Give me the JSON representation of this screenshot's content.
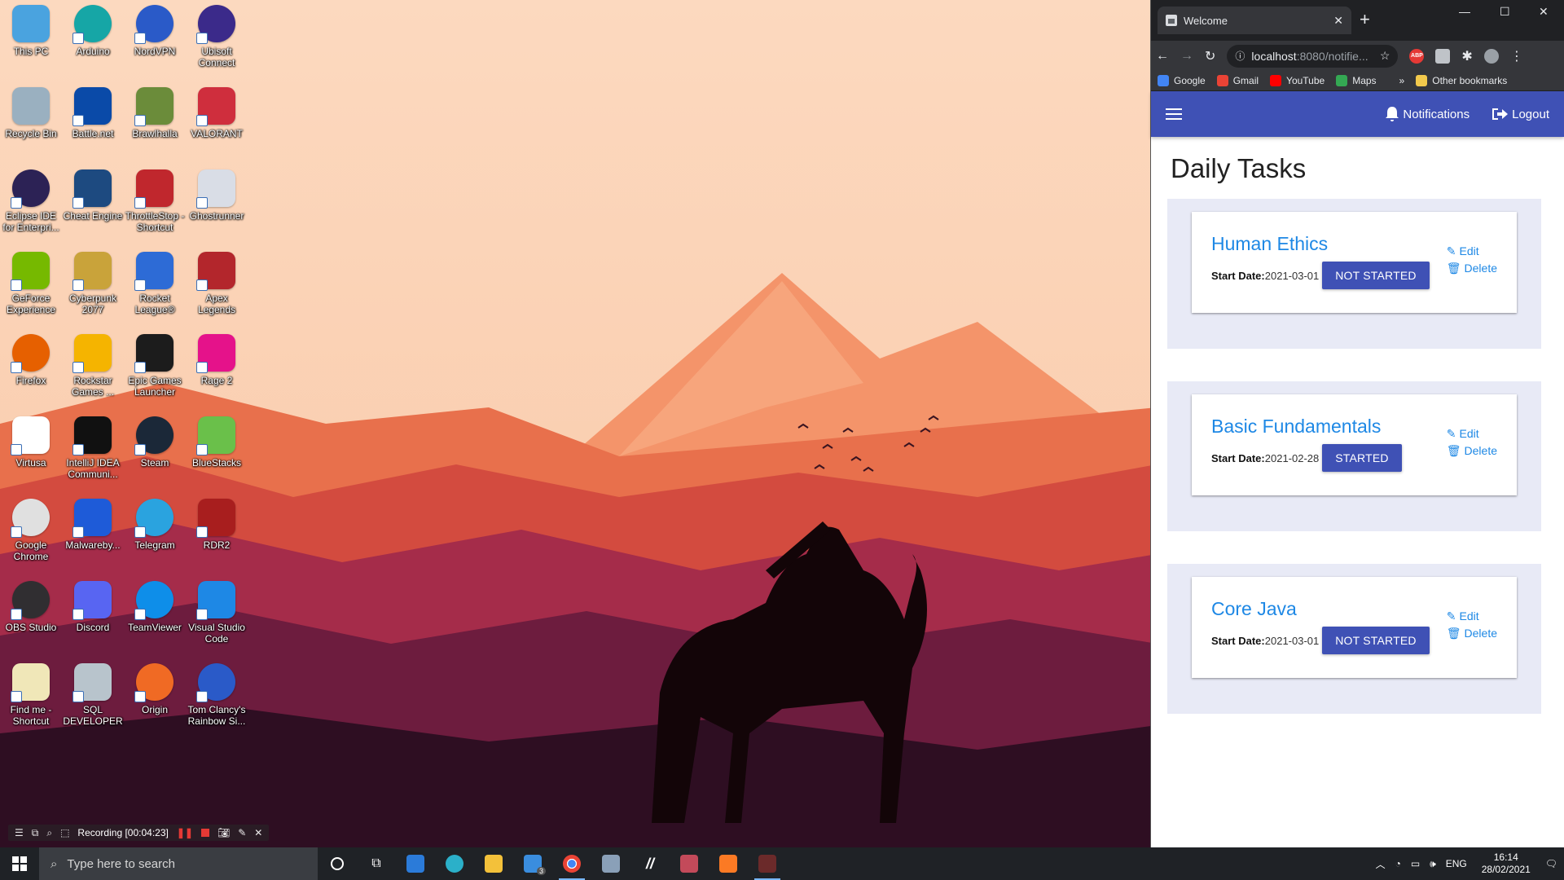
{
  "desktop": {
    "icons": [
      {
        "label": "This PC",
        "icon": "monitor-icon",
        "color": "#4aa3df"
      },
      {
        "label": "Arduino",
        "icon": "arduino-icon",
        "color": "#16a6a6"
      },
      {
        "label": "NordVPN",
        "icon": "nordvpn-icon",
        "color": "#2a5ac8"
      },
      {
        "label": "Ubisoft Connect",
        "icon": "ubisoft-icon",
        "color": "#3b2a8a"
      },
      {
        "label": "Recycle Bin",
        "icon": "recycle-bin-icon",
        "color": "#9ab0c0"
      },
      {
        "label": "Battle.net",
        "icon": "battlenet-icon",
        "color": "#0a4aa8"
      },
      {
        "label": "Brawlhalla",
        "icon": "brawlhalla-icon",
        "color": "#6b8c3a"
      },
      {
        "label": "VALORANT",
        "icon": "valorant-icon",
        "color": "#cf2e3d"
      },
      {
        "label": "Eclipse IDE for Enterpri...",
        "icon": "eclipse-icon",
        "color": "#2c2255"
      },
      {
        "label": "Cheat Engine",
        "icon": "cheat-engine-icon",
        "color": "#1d4a80"
      },
      {
        "label": "ThrottleStop - Shortcut",
        "icon": "throttlestop-icon",
        "color": "#c0272d"
      },
      {
        "label": "Ghostrunner",
        "icon": "ghostrunner-icon",
        "color": "#d9dde6"
      },
      {
        "label": "GeForce Experience",
        "icon": "geforce-icon",
        "color": "#76b900"
      },
      {
        "label": "Cyberpunk 2077",
        "icon": "cyberpunk-icon",
        "color": "#c9a33a"
      },
      {
        "label": "Rocket League®",
        "icon": "rocket-league-icon",
        "color": "#2d6bd6"
      },
      {
        "label": "Apex Legends",
        "icon": "apex-icon",
        "color": "#b3262c"
      },
      {
        "label": "Firefox",
        "icon": "firefox-icon",
        "color": "#e66000"
      },
      {
        "label": "Rockstar Games ...",
        "icon": "rockstar-icon",
        "color": "#f5b400"
      },
      {
        "label": "Epic Games Launcher",
        "icon": "epic-games-icon",
        "color": "#1c1c1c"
      },
      {
        "label": "Rage 2",
        "icon": "rage2-icon",
        "color": "#e5128a"
      },
      {
        "label": "Virtusa",
        "icon": "examly-icon",
        "color": "#ffffff"
      },
      {
        "label": "IntelliJ IDEA Communi...",
        "icon": "intellij-icon",
        "color": "#111111"
      },
      {
        "label": "Steam",
        "icon": "steam-icon",
        "color": "#1b2838"
      },
      {
        "label": "BlueStacks",
        "icon": "bluestacks-icon",
        "color": "#6ac04a"
      },
      {
        "label": "Google Chrome",
        "icon": "chrome-icon",
        "color": "#e0e0e0"
      },
      {
        "label": "Malwareby...",
        "icon": "malwarebytes-icon",
        "color": "#1e5bd8"
      },
      {
        "label": "Telegram",
        "icon": "telegram-icon",
        "color": "#2aa3df"
      },
      {
        "label": "RDR2",
        "icon": "rdr2-icon",
        "color": "#a81e1e"
      },
      {
        "label": "OBS Studio",
        "icon": "obs-icon",
        "color": "#302e31"
      },
      {
        "label": "Discord",
        "icon": "discord-icon",
        "color": "#5865f2"
      },
      {
        "label": "TeamViewer",
        "icon": "teamviewer-icon",
        "color": "#0e8ee9"
      },
      {
        "label": "Visual Studio Code",
        "icon": "vscode-icon",
        "color": "#1e88e5"
      },
      {
        "label": "Find me - Shortcut",
        "icon": "file-icon",
        "color": "#f0e7b8"
      },
      {
        "label": "SQL DEVELOPER",
        "icon": "sql-developer-icon",
        "color": "#b8c4cc"
      },
      {
        "label": "Origin",
        "icon": "origin-icon",
        "color": "#f06a24"
      },
      {
        "label": "Tom Clancy's Rainbow Si...",
        "icon": "rainbow-six-icon",
        "color": "#2a5ac8"
      }
    ]
  },
  "recording": {
    "label": "Recording [00:04:23]"
  },
  "taskbar": {
    "search_placeholder": "Type here to search",
    "mail_badge": "3",
    "language": "ENG",
    "time": "16:14",
    "date": "28/02/2021"
  },
  "browser": {
    "tab_title": "Welcome",
    "url_host": "localhost",
    "url_rest": ":8080/notifie...",
    "abp_label": "ABP",
    "bookmarks": [
      {
        "label": "Google",
        "color": "#4285f4"
      },
      {
        "label": "Gmail",
        "color": "#ea4335"
      },
      {
        "label": "YouTube",
        "color": "#ff0000"
      },
      {
        "label": "Maps",
        "color": "#34a853"
      }
    ],
    "more_bookmarks": "»",
    "other_bookmarks": "Other bookmarks"
  },
  "app": {
    "notifications_label": "Notifications",
    "logout_label": "Logout",
    "page_title": "Daily Tasks",
    "start_date_label": "Start Date:",
    "edit_label": "Edit",
    "delete_label": "Delete",
    "tasks": [
      {
        "title": "Human Ethics",
        "start_date": "2021-03-01",
        "status": "NOT STARTED"
      },
      {
        "title": "Basic Fundamentals",
        "start_date": "2021-02-28",
        "status": "STARTED"
      },
      {
        "title": "Core Java",
        "start_date": "2021-03-01",
        "status": "NOT STARTED"
      }
    ]
  },
  "colors": {
    "appbar": "#3f51b5",
    "task_title": "#1e88e5",
    "task_panel": "#e8eaf6"
  }
}
